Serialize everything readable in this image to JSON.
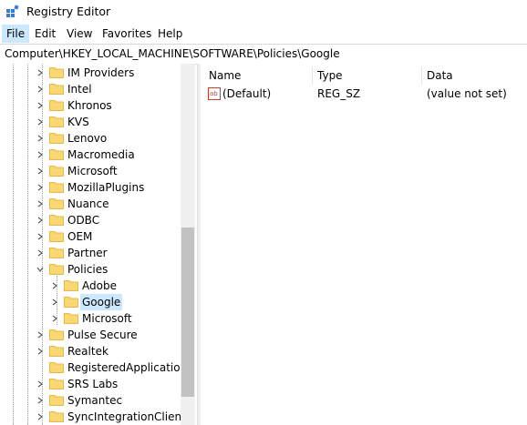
{
  "window": {
    "title": "Registry Editor"
  },
  "menu": {
    "items": [
      "File",
      "Edit",
      "View",
      "Favorites",
      "Help"
    ]
  },
  "address": {
    "path": "Computer\\HKEY_LOCAL_MACHINE\\SOFTWARE\\Policies\\Google"
  },
  "tree": {
    "items": [
      {
        "label": "IM Providers",
        "depth": 0
      },
      {
        "label": "Intel",
        "depth": 0
      },
      {
        "label": "Khronos",
        "depth": 0
      },
      {
        "label": "KVS",
        "depth": 0
      },
      {
        "label": "Lenovo",
        "depth": 0
      },
      {
        "label": "Macromedia",
        "depth": 0
      },
      {
        "label": "Microsoft",
        "depth": 0
      },
      {
        "label": "MozillaPlugins",
        "depth": 0
      },
      {
        "label": "Nuance",
        "depth": 0
      },
      {
        "label": "ODBC",
        "depth": 0
      },
      {
        "label": "OEM",
        "depth": 0
      },
      {
        "label": "Partner",
        "depth": 0
      },
      {
        "label": "Policies",
        "depth": 0,
        "expanded": true
      },
      {
        "label": "Adobe",
        "depth": 1
      },
      {
        "label": "Google",
        "depth": 1,
        "selected": true
      },
      {
        "label": "Microsoft",
        "depth": 1
      },
      {
        "label": "Pulse Secure",
        "depth": 0
      },
      {
        "label": "Realtek",
        "depth": 0
      },
      {
        "label": "RegisteredApplications",
        "depth": 0,
        "leaf": true
      },
      {
        "label": "SRS Labs",
        "depth": 0
      },
      {
        "label": "Symantec",
        "depth": 0
      },
      {
        "label": "SyncIntegrationClients",
        "depth": 0
      }
    ]
  },
  "list": {
    "columns": [
      "Name",
      "Type",
      "Data"
    ],
    "rows": [
      {
        "name": "(Default)",
        "type": "REG_SZ",
        "data": "(value not set)"
      }
    ]
  },
  "colors": {
    "selection": "#cce8ff",
    "folder": "#f8d775",
    "folder_dark": "#e8b84b",
    "ab_icon": "#c8402a"
  }
}
